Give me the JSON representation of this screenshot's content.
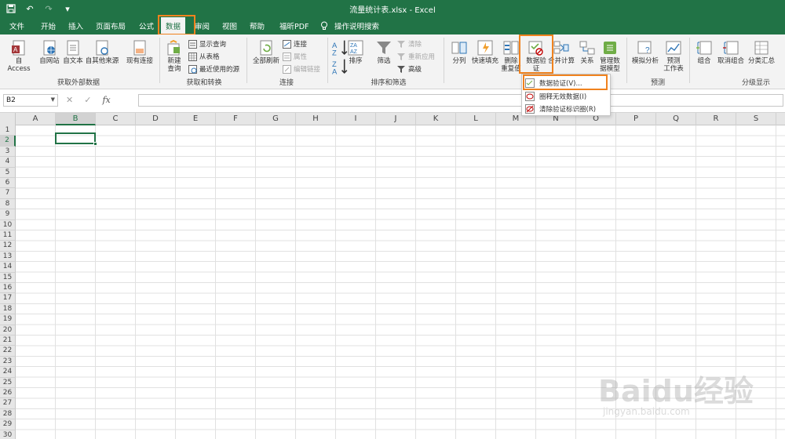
{
  "titlebar": {
    "title": "流量统计表.xlsx  -  Excel"
  },
  "tabs": [
    "文件",
    "开始",
    "插入",
    "页面布局",
    "公式",
    "数据",
    "审阅",
    "视图",
    "帮助",
    "福昕PDF"
  ],
  "active_tab": "数据",
  "tell_me": "操作说明搜索",
  "ribbon": {
    "get_external": {
      "group_label": "获取外部数据",
      "buttons": [
        "自 Access",
        "自网站",
        "自文本",
        "自其他来源",
        "现有连接"
      ]
    },
    "get_transform": {
      "group_label": "获取和转换",
      "new_query": "新建\n查询",
      "show_queries": "显示查询",
      "from_table": "从表格",
      "recent_sources": "最近使用的源"
    },
    "connections": {
      "group_label": "连接",
      "refresh_all": "全部刷新",
      "connections": "连接",
      "properties": "属性",
      "edit_links": "编辑链接"
    },
    "sort_filter": {
      "group_label": "排序和筛选",
      "sort": "排序",
      "filter": "筛选",
      "clear": "清除",
      "reapply": "重新应用",
      "advanced": "高级"
    },
    "data_tools": {
      "split": "分列",
      "flash_fill": "快速填充",
      "remove_dup": "删除\n重复值",
      "data_validation": "数据验\n证",
      "consolidate": "合并计算",
      "relationships": "关系",
      "manage_model": "管理数\n据模型"
    },
    "forecast": {
      "group_label": "预测",
      "what_if": "模拟分析",
      "forecast_sheet": "预测\n工作表"
    },
    "outline": {
      "group_label": "分级显示",
      "group": "组合",
      "ungroup": "取消组合",
      "subtotal": "分类汇总"
    }
  },
  "dropdown": {
    "items": [
      "数据验证(V)...",
      "圈释无效数据(I)",
      "清除验证标识圈(R)"
    ]
  },
  "formula_bar": {
    "name_box": "B2",
    "fx": "fx"
  },
  "grid": {
    "columns": [
      "A",
      "B",
      "C",
      "D",
      "E",
      "F",
      "G",
      "H",
      "I",
      "J",
      "K",
      "L",
      "M",
      "N",
      "O",
      "P",
      "Q",
      "R",
      "S"
    ],
    "rows": [
      "1",
      "2",
      "3",
      "4",
      "5",
      "6",
      "7",
      "8",
      "9",
      "10",
      "11",
      "12",
      "13",
      "14",
      "15",
      "16",
      "17",
      "18",
      "19",
      "20",
      "21",
      "22",
      "23",
      "24",
      "25",
      "26",
      "27",
      "28",
      "29",
      "30"
    ],
    "selected_cell": "B2"
  },
  "watermark": {
    "brand": "Baidu经验",
    "url": "jingyan.baidu.com"
  },
  "colors": {
    "excel_green": "#217346",
    "highlight_orange": "#f0821e"
  }
}
